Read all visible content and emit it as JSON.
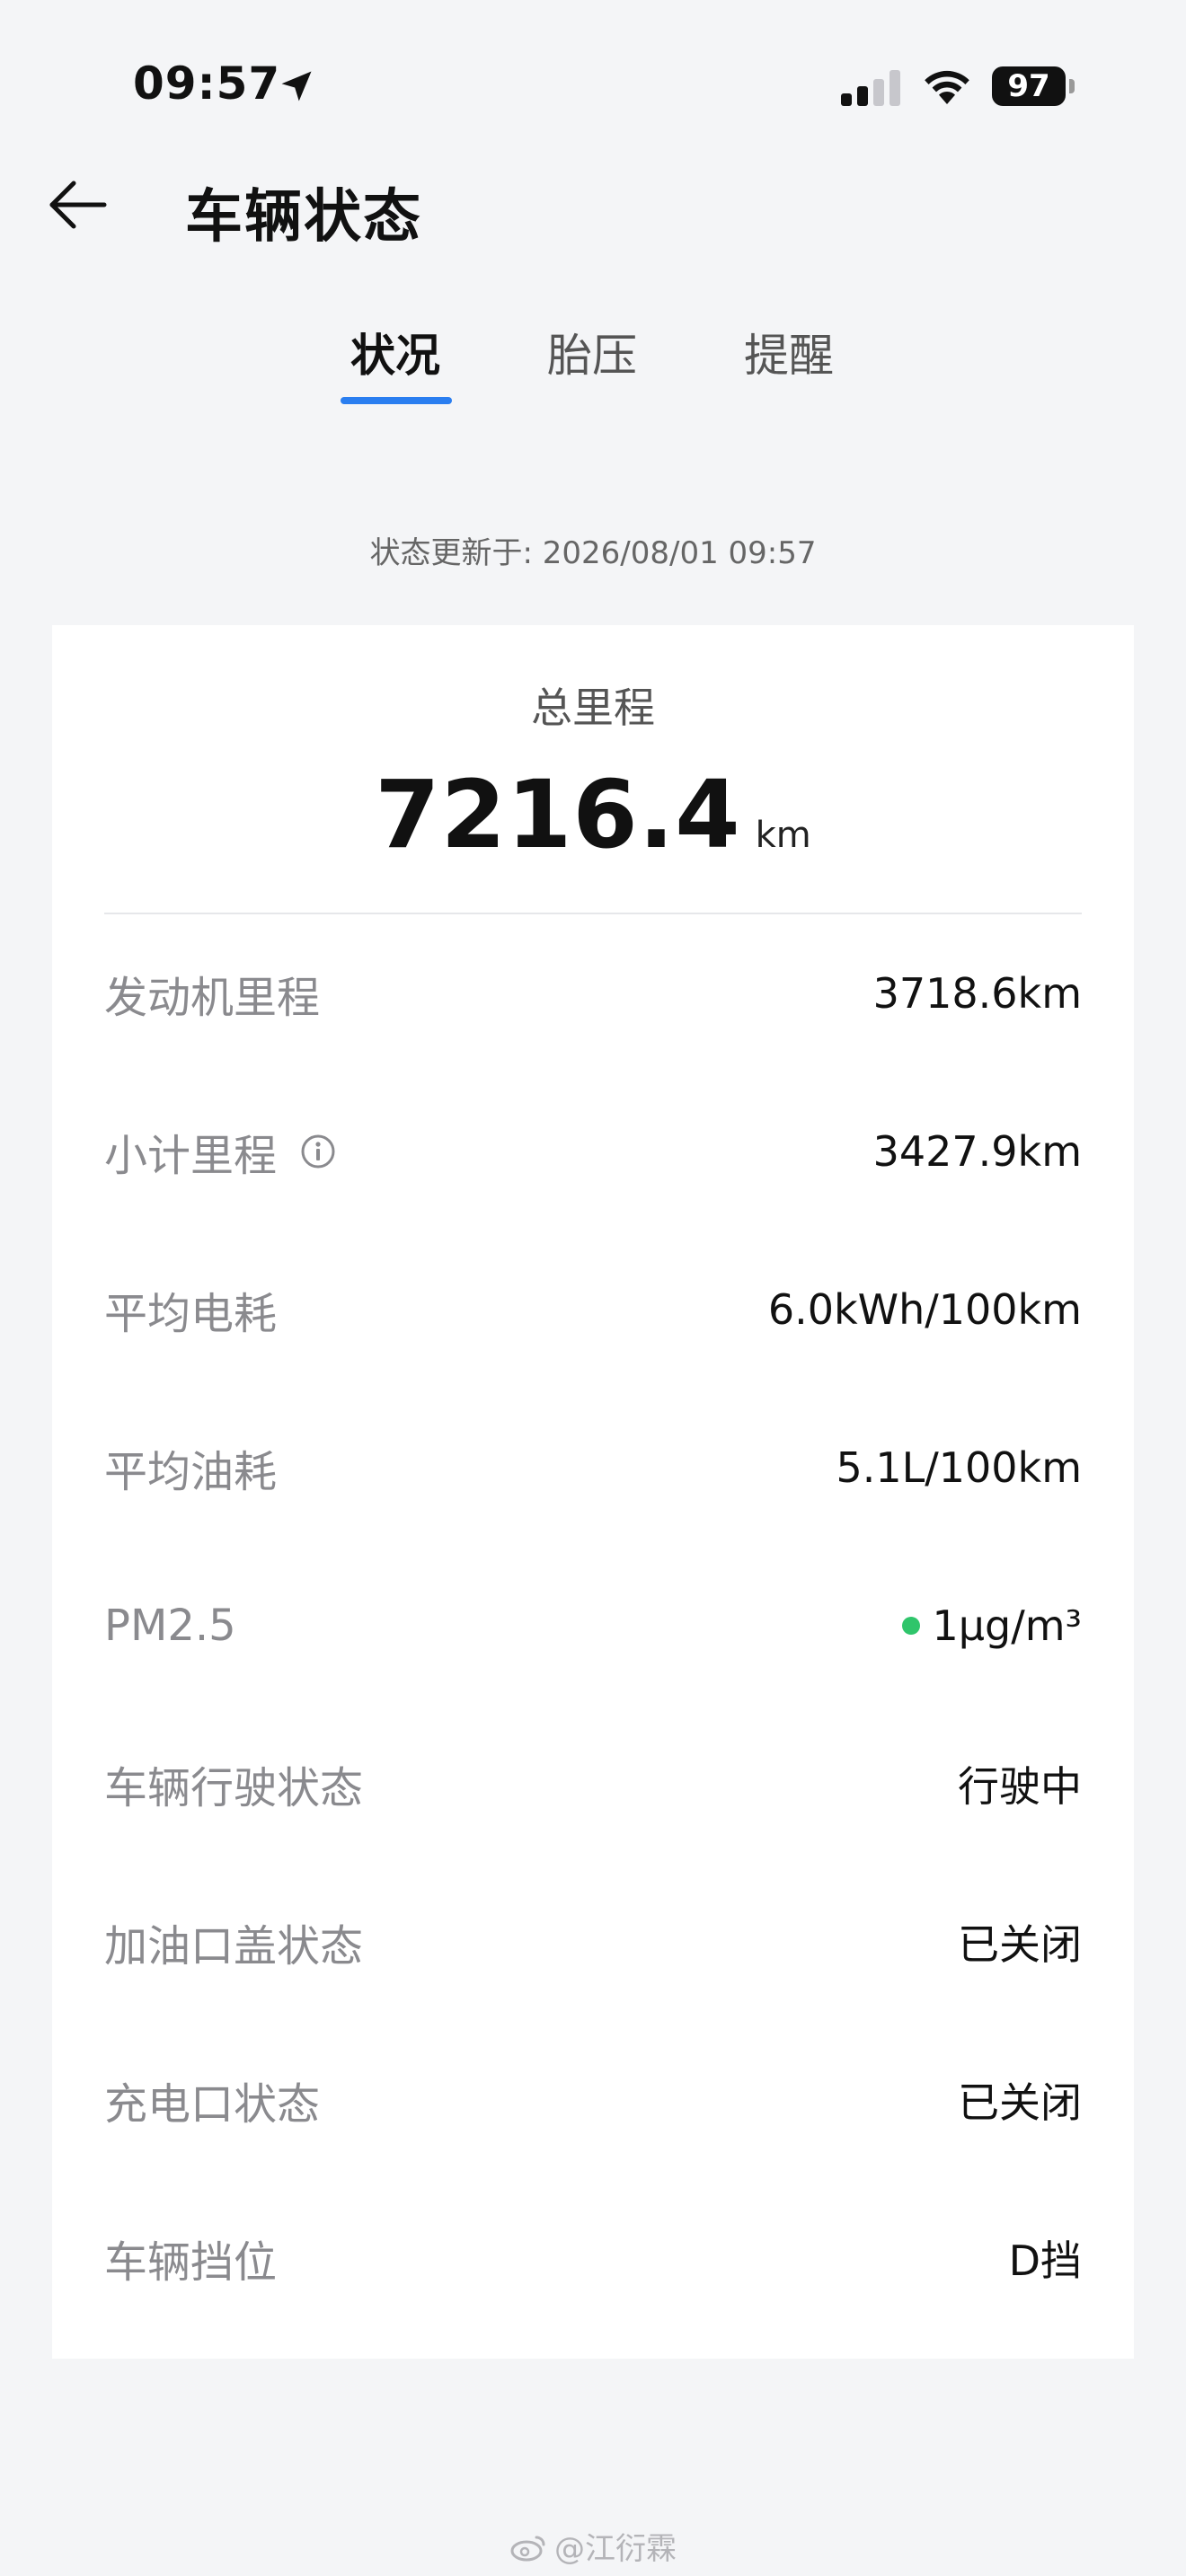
{
  "status_bar": {
    "time": "09:57",
    "location_icon": "location-arrow-icon",
    "signal_icon": "cellular-signal-icon",
    "wifi_icon": "wifi-icon",
    "battery": "97"
  },
  "header": {
    "back_icon": "arrow-left-icon",
    "title": "车辆状态"
  },
  "tabs": [
    {
      "label": "状况",
      "active": true
    },
    {
      "label": "胎压",
      "active": false
    },
    {
      "label": "提醒",
      "active": false
    }
  ],
  "updated_text": "状态更新于: 2026/08/01 09:57",
  "summary": {
    "label": "总里程",
    "value": "7216.4",
    "unit": "km"
  },
  "rows": [
    {
      "label": "发动机里程",
      "value": "3718.6km"
    },
    {
      "label": "小计里程",
      "value": "3427.9km",
      "info_icon": "info-icon"
    },
    {
      "label": "平均电耗",
      "value": "6.0kWh/100km"
    },
    {
      "label": "平均油耗",
      "value": "5.1L/100km"
    },
    {
      "label": "PM2.5",
      "value": "1μg/m³",
      "indicator_color": "#2fc56b"
    },
    {
      "label": "车辆行驶状态",
      "value": "行驶中"
    },
    {
      "label": "加油口盖状态",
      "value": "已关闭"
    },
    {
      "label": "充电口状态",
      "value": "已关闭"
    },
    {
      "label": "车辆挡位",
      "value": "D挡"
    }
  ],
  "accent_color": "#2a7ef0",
  "watermark": "@江衍霖"
}
